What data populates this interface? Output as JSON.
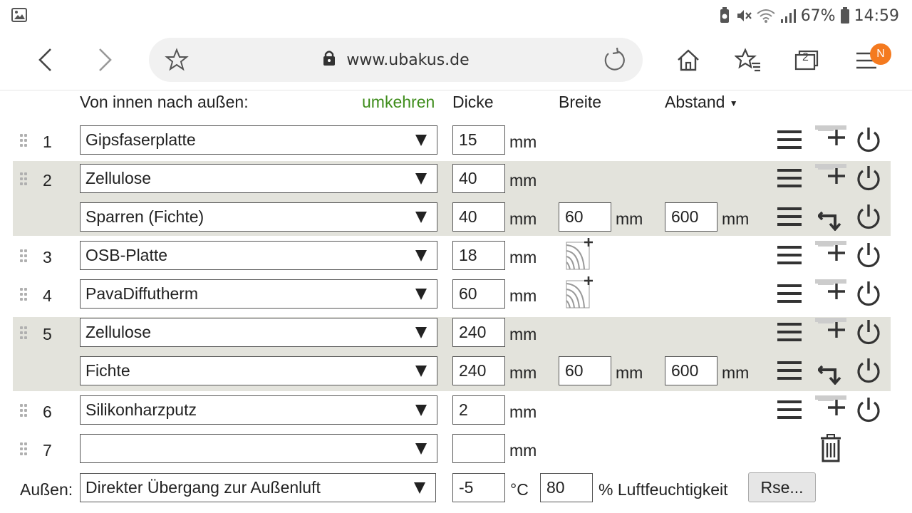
{
  "status_bar": {
    "battery": "67%",
    "time": "14:59"
  },
  "browser": {
    "url": "www.ubakus.de",
    "tabs_count": "2",
    "menu_badge": "N"
  },
  "headers": {
    "direction": "Von innen nach außen:",
    "reverse": "umkehren",
    "thickness": "Dicke",
    "width": "Breite",
    "spacing": "Abstand"
  },
  "unit": "mm",
  "layers": [
    {
      "num": "1",
      "material": "Gipsfaserplatte",
      "thickness": "15"
    },
    {
      "num": "2",
      "material": "Zellulose",
      "thickness": "40"
    },
    {
      "num": "",
      "material": "Sparren (Fichte)",
      "thickness": "40",
      "width": "60",
      "spacing": "600"
    },
    {
      "num": "3",
      "material": "OSB-Platte",
      "thickness": "18"
    },
    {
      "num": "4",
      "material": "PavaDiffutherm",
      "thickness": "60"
    },
    {
      "num": "5",
      "material": "Zellulose",
      "thickness": "240"
    },
    {
      "num": "",
      "material": "Fichte",
      "thickness": "240",
      "width": "60",
      "spacing": "600"
    },
    {
      "num": "6",
      "material": "Silikonharzputz",
      "thickness": "2"
    },
    {
      "num": "7",
      "material": "",
      "thickness": ""
    }
  ],
  "outside": {
    "label": "Außen:",
    "condition": "Direkter Übergang zur Außenluft",
    "temperature": "-5",
    "temp_unit": "°C",
    "humidity": "80",
    "humidity_label": "% Luftfeuchtigkeit",
    "rse_button": "Rse..."
  },
  "colors": {
    "accent_green": "#3d8c1a",
    "group_bg": "#e3e3dc",
    "badge": "#f47a1f"
  }
}
